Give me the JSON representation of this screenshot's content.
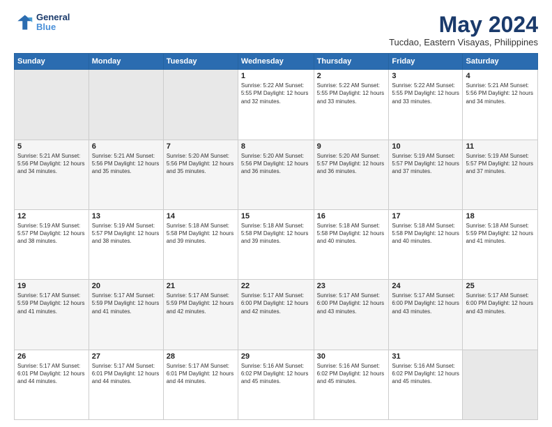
{
  "header": {
    "logo_line1": "General",
    "logo_line2": "Blue",
    "month": "May 2024",
    "location": "Tucdao, Eastern Visayas, Philippines"
  },
  "weekdays": [
    "Sunday",
    "Monday",
    "Tuesday",
    "Wednesday",
    "Thursday",
    "Friday",
    "Saturday"
  ],
  "weeks": [
    [
      {
        "day": "",
        "info": ""
      },
      {
        "day": "",
        "info": ""
      },
      {
        "day": "",
        "info": ""
      },
      {
        "day": "1",
        "info": "Sunrise: 5:22 AM\nSunset: 5:55 PM\nDaylight: 12 hours\nand 32 minutes."
      },
      {
        "day": "2",
        "info": "Sunrise: 5:22 AM\nSunset: 5:55 PM\nDaylight: 12 hours\nand 33 minutes."
      },
      {
        "day": "3",
        "info": "Sunrise: 5:22 AM\nSunset: 5:55 PM\nDaylight: 12 hours\nand 33 minutes."
      },
      {
        "day": "4",
        "info": "Sunrise: 5:21 AM\nSunset: 5:56 PM\nDaylight: 12 hours\nand 34 minutes."
      }
    ],
    [
      {
        "day": "5",
        "info": "Sunrise: 5:21 AM\nSunset: 5:56 PM\nDaylight: 12 hours\nand 34 minutes."
      },
      {
        "day": "6",
        "info": "Sunrise: 5:21 AM\nSunset: 5:56 PM\nDaylight: 12 hours\nand 35 minutes."
      },
      {
        "day": "7",
        "info": "Sunrise: 5:20 AM\nSunset: 5:56 PM\nDaylight: 12 hours\nand 35 minutes."
      },
      {
        "day": "8",
        "info": "Sunrise: 5:20 AM\nSunset: 5:56 PM\nDaylight: 12 hours\nand 36 minutes."
      },
      {
        "day": "9",
        "info": "Sunrise: 5:20 AM\nSunset: 5:57 PM\nDaylight: 12 hours\nand 36 minutes."
      },
      {
        "day": "10",
        "info": "Sunrise: 5:19 AM\nSunset: 5:57 PM\nDaylight: 12 hours\nand 37 minutes."
      },
      {
        "day": "11",
        "info": "Sunrise: 5:19 AM\nSunset: 5:57 PM\nDaylight: 12 hours\nand 37 minutes."
      }
    ],
    [
      {
        "day": "12",
        "info": "Sunrise: 5:19 AM\nSunset: 5:57 PM\nDaylight: 12 hours\nand 38 minutes."
      },
      {
        "day": "13",
        "info": "Sunrise: 5:19 AM\nSunset: 5:57 PM\nDaylight: 12 hours\nand 38 minutes."
      },
      {
        "day": "14",
        "info": "Sunrise: 5:18 AM\nSunset: 5:58 PM\nDaylight: 12 hours\nand 39 minutes."
      },
      {
        "day": "15",
        "info": "Sunrise: 5:18 AM\nSunset: 5:58 PM\nDaylight: 12 hours\nand 39 minutes."
      },
      {
        "day": "16",
        "info": "Sunrise: 5:18 AM\nSunset: 5:58 PM\nDaylight: 12 hours\nand 40 minutes."
      },
      {
        "day": "17",
        "info": "Sunrise: 5:18 AM\nSunset: 5:58 PM\nDaylight: 12 hours\nand 40 minutes."
      },
      {
        "day": "18",
        "info": "Sunrise: 5:18 AM\nSunset: 5:59 PM\nDaylight: 12 hours\nand 41 minutes."
      }
    ],
    [
      {
        "day": "19",
        "info": "Sunrise: 5:17 AM\nSunset: 5:59 PM\nDaylight: 12 hours\nand 41 minutes."
      },
      {
        "day": "20",
        "info": "Sunrise: 5:17 AM\nSunset: 5:59 PM\nDaylight: 12 hours\nand 41 minutes."
      },
      {
        "day": "21",
        "info": "Sunrise: 5:17 AM\nSunset: 5:59 PM\nDaylight: 12 hours\nand 42 minutes."
      },
      {
        "day": "22",
        "info": "Sunrise: 5:17 AM\nSunset: 6:00 PM\nDaylight: 12 hours\nand 42 minutes."
      },
      {
        "day": "23",
        "info": "Sunrise: 5:17 AM\nSunset: 6:00 PM\nDaylight: 12 hours\nand 43 minutes."
      },
      {
        "day": "24",
        "info": "Sunrise: 5:17 AM\nSunset: 6:00 PM\nDaylight: 12 hours\nand 43 minutes."
      },
      {
        "day": "25",
        "info": "Sunrise: 5:17 AM\nSunset: 6:00 PM\nDaylight: 12 hours\nand 43 minutes."
      }
    ],
    [
      {
        "day": "26",
        "info": "Sunrise: 5:17 AM\nSunset: 6:01 PM\nDaylight: 12 hours\nand 44 minutes."
      },
      {
        "day": "27",
        "info": "Sunrise: 5:17 AM\nSunset: 6:01 PM\nDaylight: 12 hours\nand 44 minutes."
      },
      {
        "day": "28",
        "info": "Sunrise: 5:17 AM\nSunset: 6:01 PM\nDaylight: 12 hours\nand 44 minutes."
      },
      {
        "day": "29",
        "info": "Sunrise: 5:16 AM\nSunset: 6:02 PM\nDaylight: 12 hours\nand 45 minutes."
      },
      {
        "day": "30",
        "info": "Sunrise: 5:16 AM\nSunset: 6:02 PM\nDaylight: 12 hours\nand 45 minutes."
      },
      {
        "day": "31",
        "info": "Sunrise: 5:16 AM\nSunset: 6:02 PM\nDaylight: 12 hours\nand 45 minutes."
      },
      {
        "day": "",
        "info": ""
      }
    ]
  ]
}
